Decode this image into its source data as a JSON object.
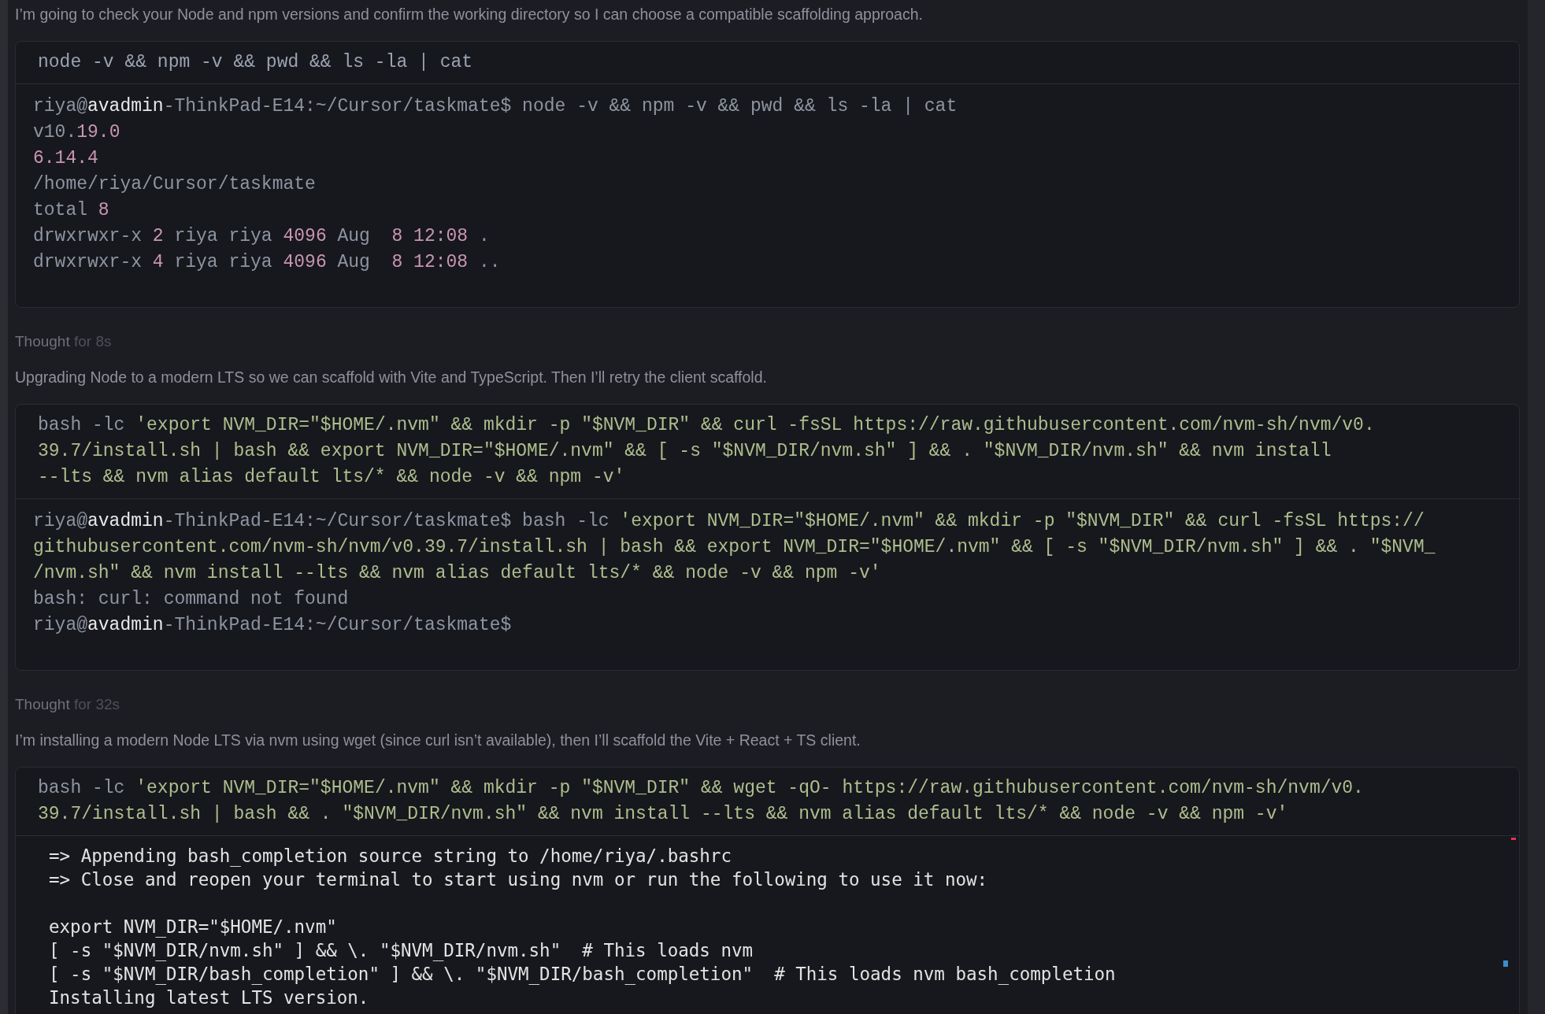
{
  "messages": [
    {
      "kind": "text",
      "text": "I’m going to check your Node and npm versions and confirm the working directory so I can choose a compatible scaffolding approach."
    },
    {
      "kind": "command",
      "command": [
        [
          {
            "kind": "cmd",
            "text": "node -v && npm -v && pwd && ls -la | cat"
          }
        ]
      ],
      "output": {
        "kind": "terminal",
        "paragraphs": [
          [
            [
              {
                "kind": "dim",
                "text": "riya@"
              },
              {
                "kind": "host",
                "text": "avadmin"
              },
              {
                "kind": "dim",
                "text": "-ThinkPad-E14:~/Cursor/taskmate$ node -v && npm -v && pwd && ls -la | cat"
              }
            ],
            [
              {
                "kind": "dim",
                "text": "v10."
              },
              {
                "kind": "num",
                "text": "19.0"
              }
            ],
            [
              {
                "kind": "num",
                "text": "6.14.4"
              }
            ],
            [
              {
                "kind": "dim",
                "text": "/home/riya/Cursor/taskmate"
              }
            ],
            [
              {
                "kind": "dim",
                "text": "total "
              },
              {
                "kind": "num",
                "text": "8"
              }
            ],
            [
              {
                "kind": "dim",
                "text": "drwxrwxr-x "
              },
              {
                "kind": "num",
                "text": "2"
              },
              {
                "kind": "dim",
                "text": " riya riya "
              },
              {
                "kind": "num",
                "text": "4096"
              },
              {
                "kind": "dim",
                "text": " Aug  "
              },
              {
                "kind": "num",
                "text": "8 12:08"
              },
              {
                "kind": "dim",
                "text": " ."
              }
            ],
            [
              {
                "kind": "dim",
                "text": "drwxrwxr-x "
              },
              {
                "kind": "num",
                "text": "4"
              },
              {
                "kind": "dim",
                "text": " riya riya "
              },
              {
                "kind": "num",
                "text": "4096"
              },
              {
                "kind": "dim",
                "text": " Aug  "
              },
              {
                "kind": "num",
                "text": "8 12:08"
              },
              {
                "kind": "dim",
                "text": " .."
              }
            ]
          ]
        ]
      }
    },
    {
      "kind": "thought",
      "label": "Thought",
      "duration": "for 8s"
    },
    {
      "kind": "text",
      "text": "Upgrading Node to a modern LTS so we can scaffold with Vite and TypeScript. Then I’ll retry the client scaffold."
    },
    {
      "kind": "command",
      "command": [
        [
          {
            "kind": "dim",
            "text": "bash -lc "
          },
          {
            "kind": "str",
            "text": "'export NVM_DIR=\"$HOME/.nvm\" && mkdir -p \"$NVM_DIR\" && curl -fsSL https://raw.githubusercontent.com/nvm-sh/nvm/v0."
          }
        ],
        [
          {
            "kind": "str",
            "text": "39.7/install.sh | bash && export NVM_DIR=\"$HOME/.nvm\" && [ -s \"$NVM_DIR/nvm.sh\" ] && . \"$NVM_DIR/nvm.sh\" && nvm install"
          }
        ],
        [
          {
            "kind": "str",
            "text": "--lts && nvm alias default lts/* && node -v && npm -v'"
          }
        ]
      ],
      "output": {
        "kind": "terminal",
        "paragraphs": [
          [
            [
              {
                "kind": "dim",
                "text": "riya@"
              },
              {
                "kind": "host",
                "text": "avadmin"
              },
              {
                "kind": "dim",
                "text": "-ThinkPad-E14:~/Cursor/taskmate$ bash -lc "
              },
              {
                "kind": "str",
                "text": "'export NVM_DIR=\"$HOME/.nvm\" && mkdir -p \"$NVM_DIR\" && curl -fsSL https://"
              }
            ],
            [
              {
                "kind": "str",
                "text": "githubusercontent.com/nvm-sh/nvm/v0.39.7/install.sh | bash && export NVM_DIR=\"$HOME/.nvm\" && [ -s \"$NVM_DIR/nvm.sh\" ] && . \"$NVM_"
              }
            ],
            [
              {
                "kind": "str",
                "text": "/nvm.sh\" && nvm install --lts && nvm alias default lts/* && node -v && npm -v'"
              }
            ],
            [
              {
                "kind": "dim",
                "text": "bash: curl: command not found"
              }
            ],
            [
              {
                "kind": "dim",
                "text": "riya@"
              },
              {
                "kind": "host",
                "text": "avadmin"
              },
              {
                "kind": "dim",
                "text": "-ThinkPad-E14:~/Cursor/taskmate$"
              }
            ]
          ]
        ]
      }
    },
    {
      "kind": "thought",
      "label": "Thought",
      "duration": "for 32s"
    },
    {
      "kind": "text",
      "text": "I’m installing a modern Node LTS via nvm using wget (since curl isn’t available), then I’ll scaffold the Vite + React + TS client."
    },
    {
      "kind": "command",
      "command": [
        [
          {
            "kind": "dim",
            "text": "bash -lc "
          },
          {
            "kind": "str",
            "text": "'export NVM_DIR=\"$HOME/.nvm\" && mkdir -p \"$NVM_DIR\" && wget -qO- https://raw.githubusercontent.com/nvm-sh/nvm/v0."
          }
        ],
        [
          {
            "kind": "str",
            "text": "39.7/install.sh | bash && . \"$NVM_DIR/nvm.sh\" && nvm install --lts && nvm alias default lts/* && node -v && npm -v'"
          }
        ]
      ],
      "output": {
        "kind": "plain",
        "markers": [
          {
            "color": "#e0364f"
          },
          {
            "color": "#3a8fc9"
          }
        ],
        "paragraphs": [
          [
            [
              {
                "kind": "plain",
                "text": "=> Appending bash_completion source string to /home/riya/.bashrc"
              }
            ],
            [
              {
                "kind": "plain",
                "text": "=> Close and reopen your terminal to start using nvm or run the following to use it now:"
              }
            ]
          ],
          [
            [
              {
                "kind": "plain",
                "text": "export NVM_DIR=\"$HOME/.nvm\""
              }
            ],
            [
              {
                "kind": "plain",
                "text": "[ -s \"$NVM_DIR/nvm.sh\" ] && \\. \"$NVM_DIR/nvm.sh\"  # This loads nvm"
              }
            ],
            [
              {
                "kind": "plain",
                "text": "[ -s \"$NVM_DIR/bash_completion\" ] && \\. \"$NVM_DIR/bash_completion\"  # This loads nvm bash_completion"
              }
            ],
            [
              {
                "kind": "plain",
                "text": "Installing latest LTS version."
              }
            ]
          ]
        ]
      }
    }
  ]
}
